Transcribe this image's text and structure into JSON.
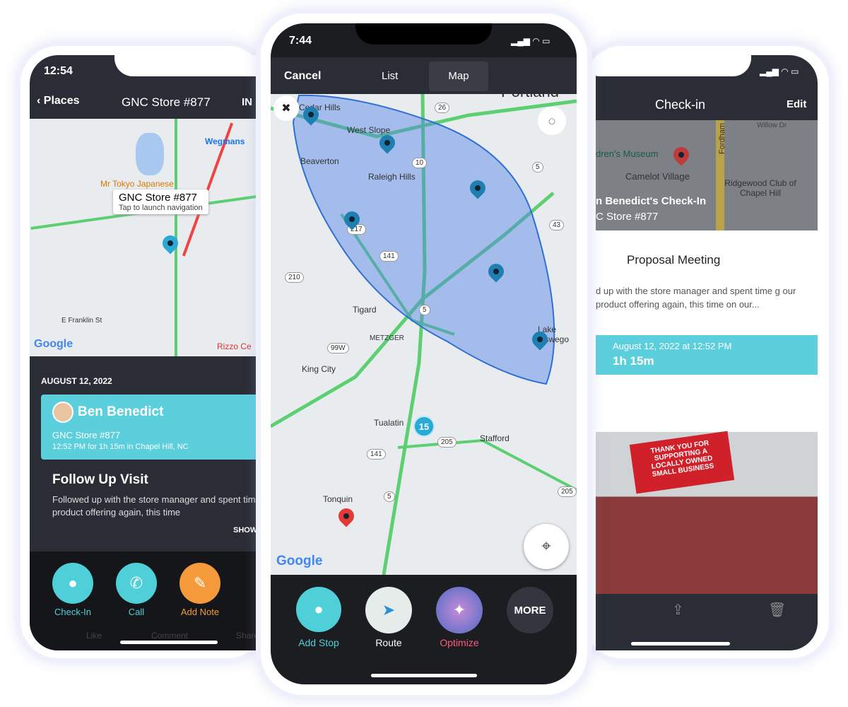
{
  "left": {
    "time": "12:54",
    "back": "Places",
    "title": "GNC Store #877",
    "right_cut": "IN",
    "map": {
      "callout_title": "GNC Store #877",
      "callout_sub": "Tap to launch navigation",
      "labels": [
        "Wegmans",
        "Mr Tokyo Japanese",
        "E Franklin St",
        "Rizzo Ce",
        "Google"
      ]
    },
    "date": "AUGUST 12, 2022",
    "card": {
      "name": "Ben Benedict",
      "store": "GNC Store #877",
      "detail": "12:52 PM for 1h 15m in Chapel Hill, NC"
    },
    "note": {
      "title": "Follow Up Visit",
      "body": "Followed up with the store manager and spent time reviewing our product offering again, this time",
      "show": "SHOW"
    },
    "actions": [
      {
        "label": "Check-In",
        "color": "#4fd0d8"
      },
      {
        "label": "Call",
        "color": "#4fd0d8"
      },
      {
        "label": "Add Note",
        "color": "#f49a3a"
      }
    ],
    "social": [
      "Like",
      "Comment",
      "Share"
    ]
  },
  "center": {
    "time": "7:44",
    "cancel": "Cancel",
    "tabs": [
      {
        "label": "List"
      },
      {
        "label": "Map",
        "active": true
      }
    ],
    "map": {
      "places": [
        "Cedar Hills",
        "West Slope",
        "Portland",
        "Beaverton",
        "Raleigh Hills",
        "Tigard",
        "METZGER",
        "King City",
        "Tualatin",
        "Stafford",
        "Tonquin",
        "Lake Oswego"
      ],
      "shields": [
        "26",
        "10",
        "5",
        "217",
        "141",
        "210",
        "99W",
        "43",
        "5",
        "205",
        "141",
        "5",
        "205"
      ],
      "cluster": "15",
      "logo": "Google"
    },
    "actions": [
      {
        "label": "Add Stop",
        "color": "#4fd0d8"
      },
      {
        "label": "Route",
        "color": "#ffffff"
      },
      {
        "label": "Optimize",
        "color": "#ff5a7a"
      },
      {
        "label": "MORE"
      }
    ]
  },
  "right": {
    "title": "Check-in",
    "edit": "Edit",
    "map": {
      "labels": [
        "dren's Museum",
        "Camelot Village",
        "Ridgewood Club of Chapel Hill",
        "Fordham",
        "Willow Dr"
      ],
      "overlay_title": "n Benedict's Check-In",
      "overlay_sub": "C Store #877"
    },
    "meeting": "Proposal Meeting",
    "body": "d up with the store manager and spent time g our product offering again, this time on our...",
    "when": "August 12, 2022 at 12:52 PM",
    "duration": "1h 15m",
    "banner": "THANK YOU FOR SUPPORTING A LOCALLY OWNED SMALL BUSINESS"
  },
  "colors": {
    "teal": "#4fd0d8",
    "dark": "#2a2d35",
    "orange": "#f49a3a"
  }
}
